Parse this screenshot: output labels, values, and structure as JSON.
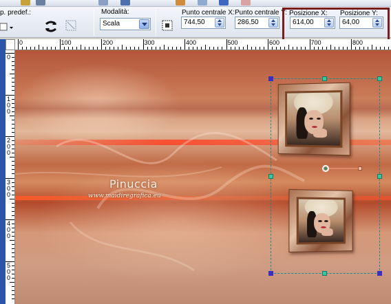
{
  "toolbar": {
    "preset_label": "p. predef.:",
    "mode_label": "Modalità:",
    "mode_value": "Scala",
    "center_x_label": "Punto centrale X:",
    "center_x_value": "744,50",
    "center_y_label": "Punto centrale Y:",
    "center_y_value": "286,50",
    "pos_x_label": "Posizione X:",
    "pos_x_value": "614,00",
    "pos_y_label": "Posizione Y:",
    "pos_y_value": "64,00"
  },
  "ruler_top": [
    "0",
    "100",
    "200",
    "300",
    "400",
    "500",
    "600",
    "700",
    "800"
  ],
  "ruler_left": [
    "0",
    "1\n0\n0",
    "2\n0\n0",
    "3\n0\n0",
    "4\n0\n0",
    "5\n0\n0"
  ],
  "canvas": {
    "watermark_title": "Pinuccia",
    "watermark_url": "www.maidiregrafica.eu"
  },
  "colors": {
    "highlight_box": "#7b1c1c",
    "selection_line": "#1a8c8c"
  }
}
